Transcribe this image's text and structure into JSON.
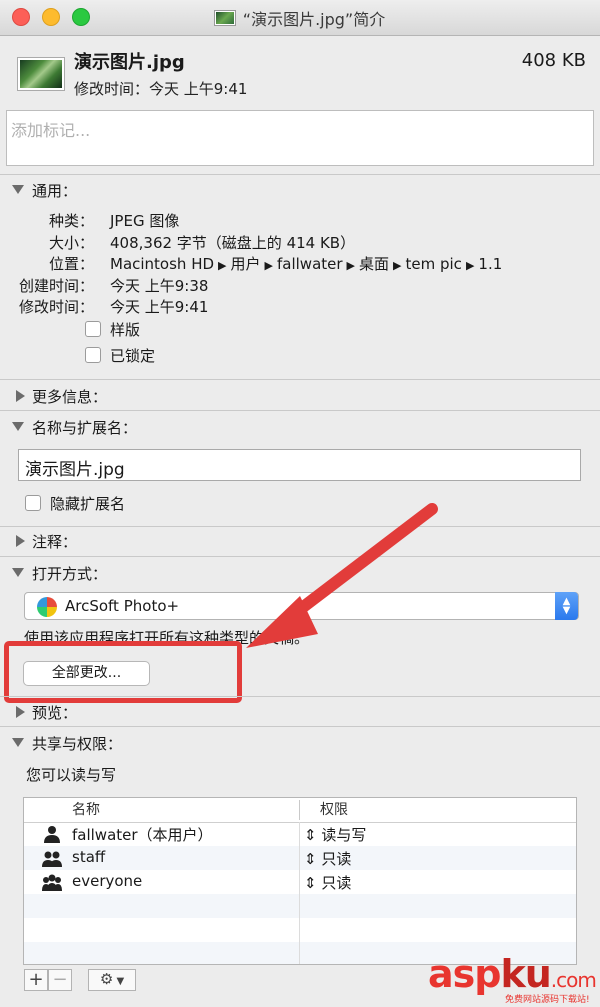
{
  "window": {
    "title": "“演示图片.jpg”简介"
  },
  "header": {
    "file_name": "演示图片.jpg",
    "file_size": "408 KB",
    "modified": "修改时间：今天 上午9:41",
    "tags_placeholder": "添加标记..."
  },
  "general": {
    "title": "通用：",
    "rows": [
      {
        "label": "种类：",
        "value": "JPEG 图像"
      },
      {
        "label": "大小：",
        "value": "408,362 字节（磁盘上的 414 KB）"
      },
      {
        "label": "创建时间：",
        "value": "今天 上午9:38"
      },
      {
        "label": "修改时间：",
        "value": "今天 上午9:41"
      }
    ],
    "where_label": "位置：",
    "path": [
      "Macintosh HD",
      "用户",
      "fallwater",
      "桌面",
      "tem pic",
      "1.1"
    ],
    "stationery": "样版",
    "locked": "已锁定"
  },
  "more_info": {
    "title": "更多信息："
  },
  "name_ext": {
    "title": "名称与扩展名：",
    "value": "演示图片.jpg",
    "hide_ext": "隐藏扩展名"
  },
  "comments": {
    "title": "注释："
  },
  "open_with": {
    "title": "打开方式：",
    "app": "ArcSoft Photo+",
    "hint": "使用该应用程序打开所有这种类型的文稿。",
    "change_all": "全部更改..."
  },
  "preview": {
    "title": "预览："
  },
  "sharing": {
    "title": "共享与权限：",
    "note": "您可以读与写",
    "col_name": "名称",
    "col_priv": "权限",
    "rows": [
      {
        "name": "fallwater（本用户）",
        "priv": "读与写",
        "icon": "single-user-icon"
      },
      {
        "name": "staff",
        "priv": "只读",
        "icon": "group-icon"
      },
      {
        "name": "everyone",
        "priv": "只读",
        "icon": "everyone-icon"
      }
    ]
  },
  "toolbar": {
    "add": "+",
    "remove": "−",
    "gear": "⚙"
  },
  "watermark": {
    "brand_a": "asp",
    "brand_b": "ku",
    "brand_c": ".com",
    "sub": "免费网站源码下载站!"
  },
  "colors": {
    "highlight": "#e23c3a",
    "accent": "#2a79ed"
  }
}
